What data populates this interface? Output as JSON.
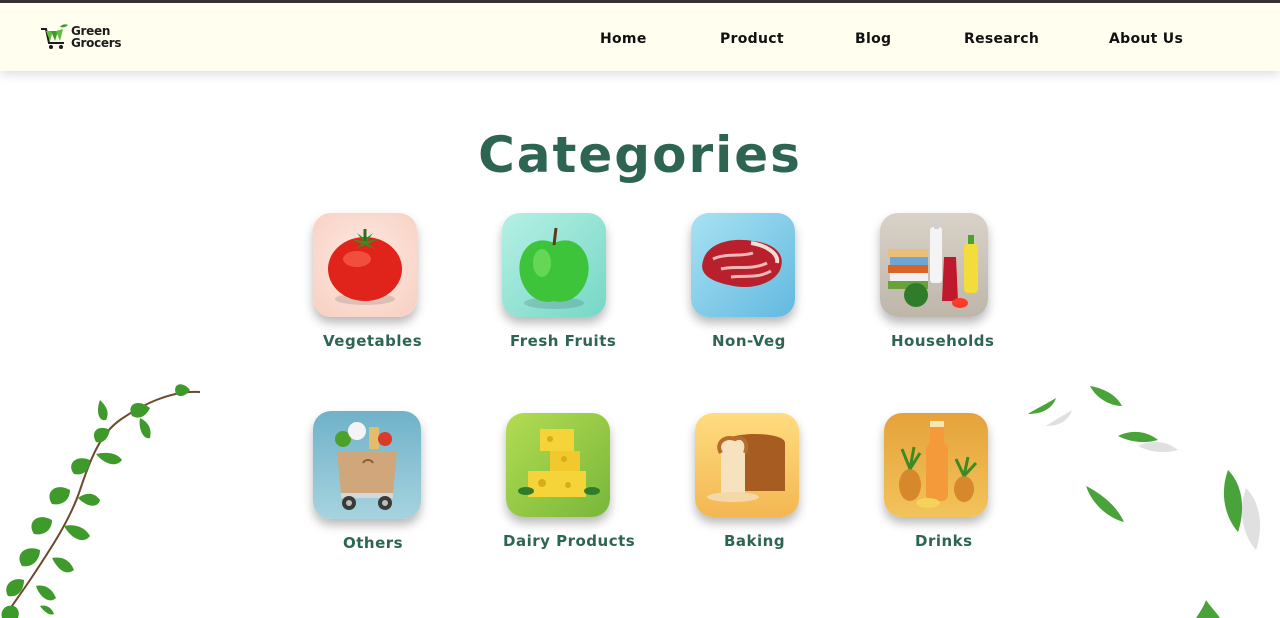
{
  "brand": {
    "name_line1": "Green",
    "name_line2": "Grocers"
  },
  "nav": {
    "items": [
      {
        "label": "Home"
      },
      {
        "label": "Product"
      },
      {
        "label": "Blog"
      },
      {
        "label": "Research"
      },
      {
        "label": "About Us"
      }
    ]
  },
  "main": {
    "title": "Categories",
    "categories": [
      {
        "label": "Vegetables",
        "icon": "tomato-icon"
      },
      {
        "label": "Fresh Fruits",
        "icon": "green-apple-icon"
      },
      {
        "label": "Non-Veg",
        "icon": "meat-steak-icon"
      },
      {
        "label": "Households",
        "icon": "household-products-icon"
      },
      {
        "label": "Others",
        "icon": "grocery-bag-cart-icon"
      },
      {
        "label": "Dairy Products",
        "icon": "cheese-icon"
      },
      {
        "label": "Baking",
        "icon": "bread-loaf-icon"
      },
      {
        "label": "Drinks",
        "icon": "juice-bottle-icon"
      }
    ]
  },
  "colors": {
    "accent": "#2e6552",
    "header_bg": "#fffeef",
    "leaf": "#3f9a2c"
  }
}
